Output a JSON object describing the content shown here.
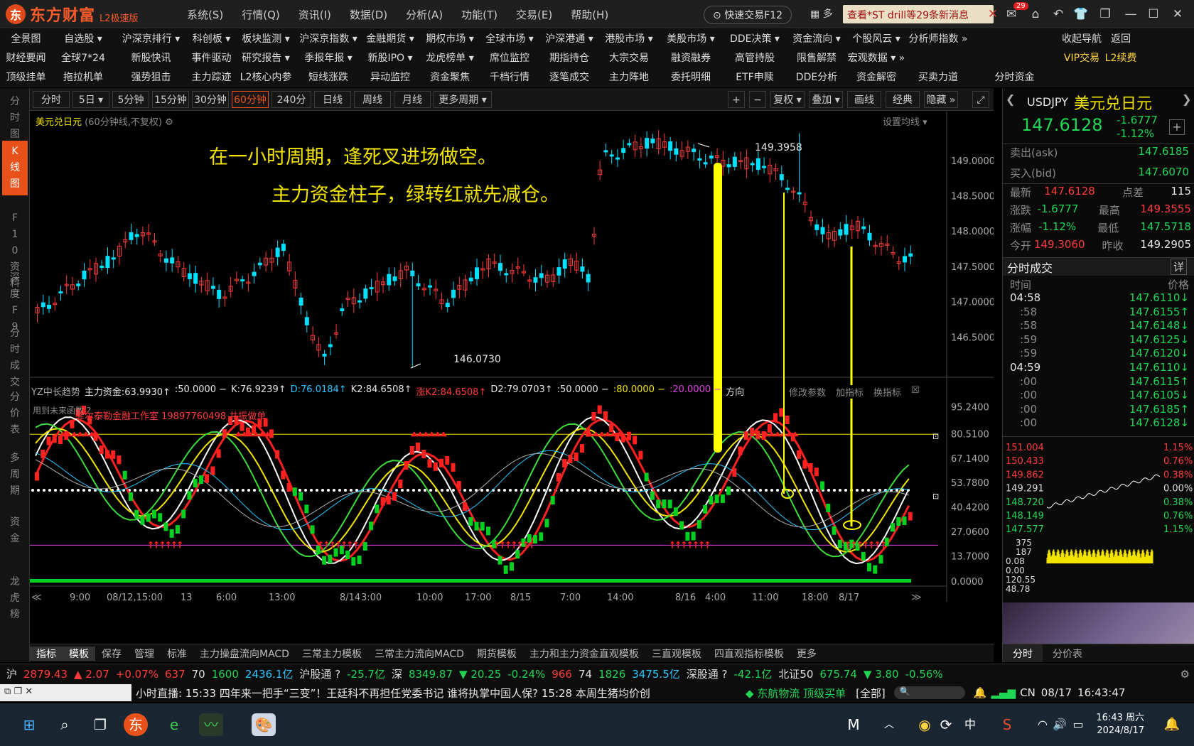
{
  "app": {
    "name": "东方财富",
    "edition": "L2极速版"
  },
  "menu": [
    "系统(S)",
    "行情(Q)",
    "资讯(I)",
    "数据(D)",
    "分析(A)",
    "功能(T)",
    "交易(E)",
    "帮助(H)"
  ],
  "quick_trade": "快速交易F12",
  "grid_label": "多",
  "news_button": "查看*ST drill等29条新消息",
  "mail_badge": "29",
  "nav_rows": [
    [
      "全景图",
      "自选股 ▾",
      "沪深京排行 ▾",
      "科创板 ▾",
      "板块监测 ▾",
      "沪深京指数 ▾",
      "金融期货 ▾",
      "期权市场 ▾",
      "全球市场 ▾",
      "沪深港通 ▾",
      "港股市场 ▾",
      "美股市场 ▾",
      "DDE决策 ▾",
      "资金流向 ▾",
      "个股风云 ▾",
      "分析师指数 »",
      "",
      "收起导航",
      "返回"
    ],
    [
      "财经要闻",
      "全球7*24",
      "新股快讯",
      "事件驱动",
      "研究报告 ▾",
      "季报年报 ▾",
      "新股IPO ▾",
      "龙虎榜单 ▾",
      "席位监控",
      "期指持仓",
      "大宗交易",
      "融资融券",
      "高管持股",
      "限售解禁",
      "宏观数据 ▾ »",
      "",
      "",
      "VIP交易",
      "L2续费"
    ],
    [
      "顶级挂单",
      "拖拉机单",
      "强势狙击",
      "主力踪迹",
      "L2核心内参",
      "短线涨跌",
      "异动监控",
      "资金聚焦",
      "千档行情",
      "逐笔成交",
      "主力阵地",
      "委托明细",
      "ETF申赎",
      "DDE分析",
      "资金解密",
      "买卖力道",
      "分时资金",
      "",
      ""
    ]
  ],
  "left_tabs": [
    "分时图",
    "K线图",
    "F10资料",
    "深度F9",
    "分时成交",
    "分价表",
    "多周期",
    "资金",
    "龙虎榜"
  ],
  "periods": [
    "分时",
    "5日 ▾",
    "5分钟",
    "15分钟",
    "30分钟",
    "60分钟",
    "240分钟",
    "日线",
    "周线",
    "月线",
    "更多周期 ▾"
  ],
  "active_period": "60分钟",
  "toolbar_right": [
    "+",
    "−",
    "复权 ▾",
    "叠加 ▾",
    "画线",
    "经典",
    "隐藏 »"
  ],
  "chart_title": "美元兑日元",
  "chart_subtitle": "(60分钟线,不复权)",
  "set_ma": "设置均线 ▾",
  "annotation1": "在一小时周期，逢死叉进场做空。",
  "annotation2": "主力资金柱子，绿转红就先减仓。",
  "hi_label": "149.3958",
  "lo_label": "146.0730",
  "price_axis": [
    "149.0000",
    "148.5000",
    "148.0000",
    "147.5000",
    "147.0000",
    "146.5000"
  ],
  "indicator": {
    "name": "YZ中长趋势",
    "values": [
      {
        "t": "主力资金:63.9930↑",
        "c": "wht"
      },
      {
        "t": ":50.0000 −",
        "c": "wht"
      },
      {
        "t": "K:76.9239↑",
        "c": "wht"
      },
      {
        "t": "D:76.0184↑",
        "c": "cyan"
      },
      {
        "t": "K2:84.6508↑",
        "c": "wht"
      },
      {
        "t": "涨K2:84.6508↑",
        "c": "red"
      },
      {
        "t": "D2:79.0703↑",
        "c": "wht"
      },
      {
        "t": ":50.0000 −",
        "c": "wht"
      },
      {
        "t": ":80.0000 −",
        "c": "yel"
      },
      {
        "t": ":20.0000 −",
        "c": "mag"
      },
      {
        "t": "方向",
        "c": "wht"
      }
    ],
    "future_note": "用到未来函数 ?",
    "watermark": "菲尔泰勒金融工作室 19897760498 共振做单",
    "actions": [
      "修改参数",
      "加指标",
      "换指标"
    ]
  },
  "ind_axis": [
    "95.2400",
    "80.5100",
    "67.1400",
    "53.7800",
    "40.4200",
    "27.0600",
    "13.7000",
    "0.0000"
  ],
  "time_axis": [
    "9:00",
    "08/12,15:00",
    "13",
    "6:00",
    "13:00",
    "8/14",
    "3:00",
    "10:00",
    "17:00",
    "8/15",
    "7:00",
    "14:00",
    "8/16",
    "4:00",
    "11:00",
    "18:00",
    "8/17"
  ],
  "bottom_tabs": [
    "指标",
    "模板",
    "保存",
    "管理",
    "标准",
    "主力操盘流向MACD",
    "三常主力模板",
    "三常主力流向MACD",
    "期货模板",
    "主力和主力资金直观模板",
    "三直观模板",
    "四直观指标模板",
    "更多"
  ],
  "quote": {
    "code": "USDJPY",
    "name": "美元兑日元",
    "price": "147.6128",
    "change": "-1.6777",
    "pct": "-1.12%",
    "rows": [
      {
        "l": "卖出(ask)",
        "v": "147.6185"
      },
      {
        "l": "买入(bid)",
        "v": "147.6070"
      }
    ],
    "stats": [
      [
        "最新",
        "147.6128",
        "点差",
        "115"
      ],
      [
        "涨跌",
        "-1.6777",
        "最高",
        "149.3555"
      ],
      [
        "涨幅",
        "-1.12%",
        "最低",
        "147.5718"
      ],
      [
        "今开",
        "149.3060",
        "昨收",
        "149.2905"
      ]
    ]
  },
  "ticks_title": "分时成交",
  "ticks_detail": "详",
  "ticks_head": [
    "时间",
    "价格"
  ],
  "ticks": [
    [
      "04:58",
      "147.6110↓"
    ],
    [
      ":58",
      "147.6155↑"
    ],
    [
      ":58",
      "147.6148↓"
    ],
    [
      ":59",
      "147.6125↓"
    ],
    [
      ":59",
      "147.6120↓"
    ],
    [
      "04:59",
      "147.6110↓"
    ],
    [
      ":00",
      "147.6115↑"
    ],
    [
      ":00",
      "147.6105↓"
    ],
    [
      ":00",
      "147.6185↑"
    ],
    [
      ":00",
      "147.6128↓"
    ]
  ],
  "mini_left": [
    "151.004",
    "150.433",
    "149.862",
    "149.291",
    "148.720",
    "148.149",
    "147.577"
  ],
  "mini_right": [
    "1.15%",
    "0.76%",
    "0.38%",
    "0.00%",
    "0.38%",
    "0.76%",
    "1.15%"
  ],
  "mini_vol": [
    "375",
    "187",
    "0.08",
    "0.00",
    "120.55",
    "48.78"
  ],
  "right_tabs": [
    "分时",
    "分价表"
  ],
  "ticker": [
    {
      "t": "沪",
      "c": "wht"
    },
    {
      "t": "2879.43",
      "c": "red"
    },
    {
      "t": "▲ 2.07",
      "c": "red"
    },
    {
      "t": "+0.07%",
      "c": "red"
    },
    {
      "t": "637",
      "c": "red"
    },
    {
      "t": "70",
      "c": "wht"
    },
    {
      "t": "1600",
      "c": "green"
    },
    {
      "t": "2436.1亿",
      "c": "cyan"
    },
    {
      "t": "沪股通 ?",
      "c": "wht"
    },
    {
      "t": "-25.7亿",
      "c": "green"
    },
    {
      "t": "深",
      "c": "wht"
    },
    {
      "t": "8349.87",
      "c": "green"
    },
    {
      "t": "▼ 20.25",
      "c": "green"
    },
    {
      "t": "-0.24%",
      "c": "green"
    },
    {
      "t": "966",
      "c": "red"
    },
    {
      "t": "74",
      "c": "wht"
    },
    {
      "t": "1826",
      "c": "green"
    },
    {
      "t": "3475.5亿",
      "c": "cyan"
    },
    {
      "t": "深股通 ?",
      "c": "wht"
    },
    {
      "t": "-42.1亿",
      "c": "green"
    },
    {
      "t": "北证50",
      "c": "wht"
    },
    {
      "t": "675.74",
      "c": "green"
    },
    {
      "t": "▼ 3.80",
      "c": "green"
    },
    {
      "t": "-0.56%",
      "c": "green"
    }
  ],
  "news_line": "小时直播: 15:33  四年来一把手“三变”！王廷科不再担任党委书记 谁将执掌中国人保?     15:28  本周生猪均价创",
  "news_stock": "◆ 东航物流 顶级买单",
  "news_all": "[全部]",
  "status": {
    "lang": "CN",
    "date": "08/17",
    "time": "16:43:47"
  },
  "clock": {
    "time": "16:43 周六",
    "date": "2024/8/17"
  },
  "colors": {
    "up": "#ff3b3b",
    "down": "#1fd655",
    "accent": "#e8521a",
    "annotation": "#f2e400"
  }
}
